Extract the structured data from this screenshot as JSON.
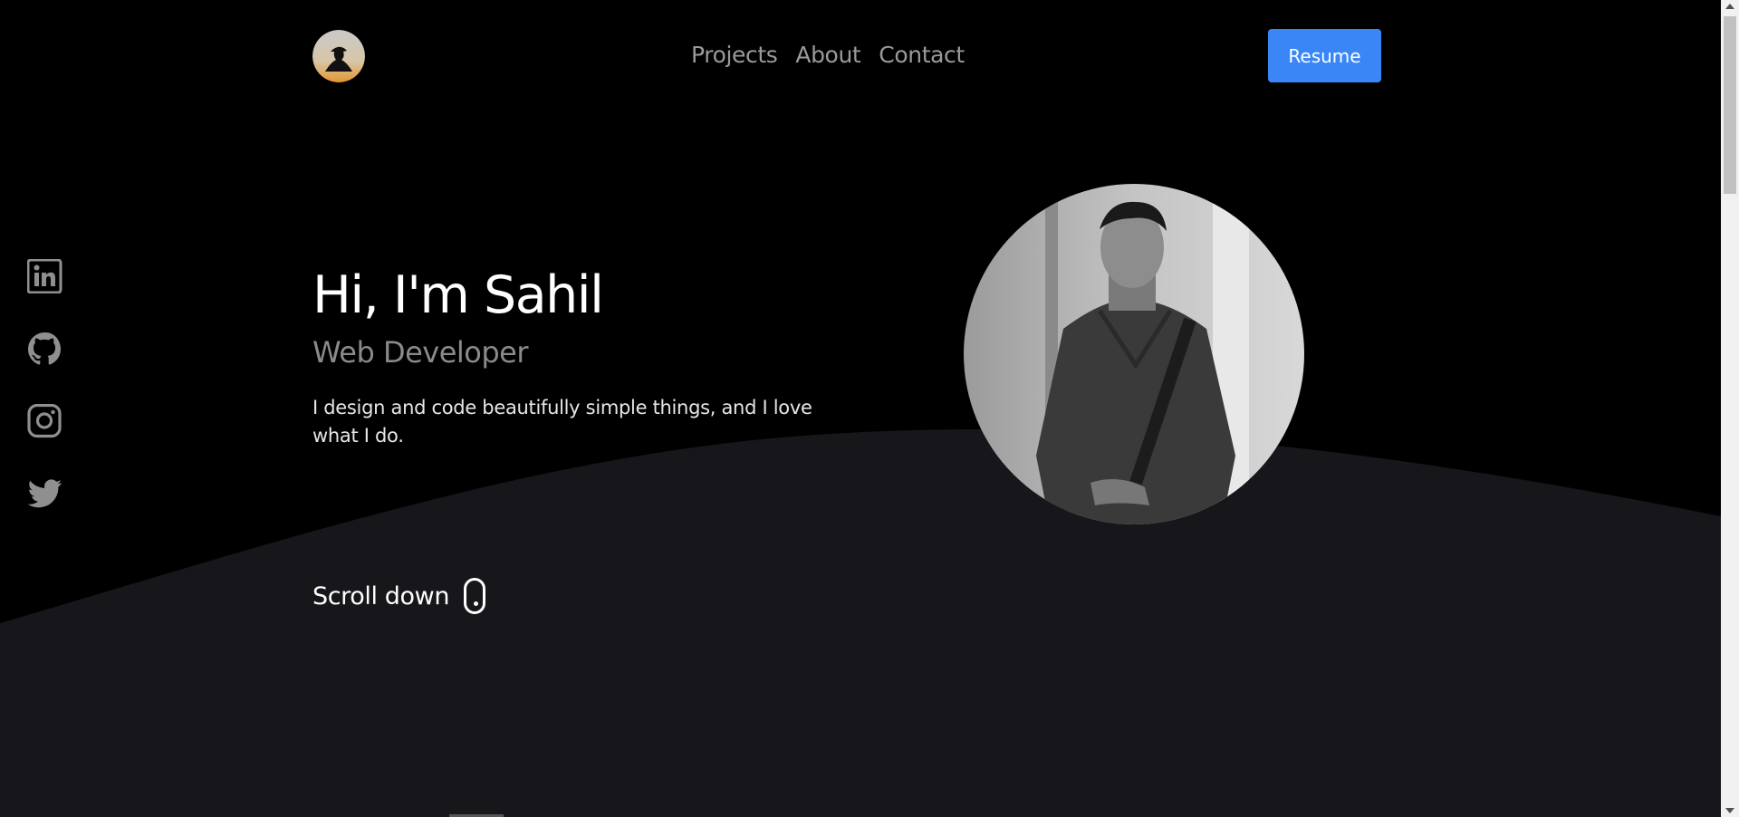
{
  "colors": {
    "background_top": "#000000",
    "background_wave": "#17171b",
    "accent_button": "#3a86f6",
    "nav_text": "#9a9a9a",
    "subtitle_text": "#8a8a8a"
  },
  "header": {
    "logo_icon": "avatar-silhouette-logo",
    "nav": [
      {
        "label": "Projects"
      },
      {
        "label": "About"
      },
      {
        "label": "Contact"
      }
    ],
    "resume_label": "Resume"
  },
  "social": [
    {
      "icon": "linkedin-icon"
    },
    {
      "icon": "github-icon"
    },
    {
      "icon": "instagram-icon"
    },
    {
      "icon": "twitter-icon"
    }
  ],
  "hero": {
    "title": "Hi, I'm Sahil",
    "subtitle": "Web Developer",
    "description": "I design and code beautifully simple things, and I love what I do.",
    "portrait_icon": "profile-photo"
  },
  "scroll": {
    "label": "Scroll down",
    "icon": "mouse-icon"
  }
}
